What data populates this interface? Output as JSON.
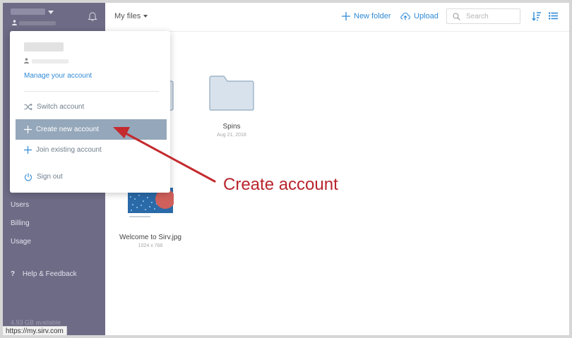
{
  "sidebar": {
    "nav": [
      "Users",
      "Billing",
      "Usage"
    ],
    "help": "Help & Feedback",
    "help_icon": "?",
    "storage": "4.93 GB available"
  },
  "topbar": {
    "my_files": "My files",
    "new_folder": "New folder",
    "upload": "Upload",
    "search_placeholder": "Search"
  },
  "files": [
    {
      "name": "Spins",
      "meta": "Aug 21, 2018",
      "kind": "folder"
    },
    {
      "name": "Welcome to Sirv.jpg",
      "meta": "1024 x 768",
      "kind": "image"
    }
  ],
  "dropdown": {
    "manage": "Manage your account",
    "items": [
      {
        "label": "Switch account",
        "icon": "shuffle-icon"
      },
      {
        "label": "Create new account",
        "icon": "plus-icon",
        "active": true
      },
      {
        "label": "Join existing account",
        "icon": "plus-icon"
      },
      {
        "label": "Sign out",
        "icon": "power-icon"
      }
    ]
  },
  "annotation": "Create account",
  "status_url": "https://my.sirv.com",
  "colors": {
    "sidebar": "#6d6b85",
    "accent": "#2f8ad6",
    "active_item": "#95a7ba",
    "annotation": "#b8252d"
  }
}
